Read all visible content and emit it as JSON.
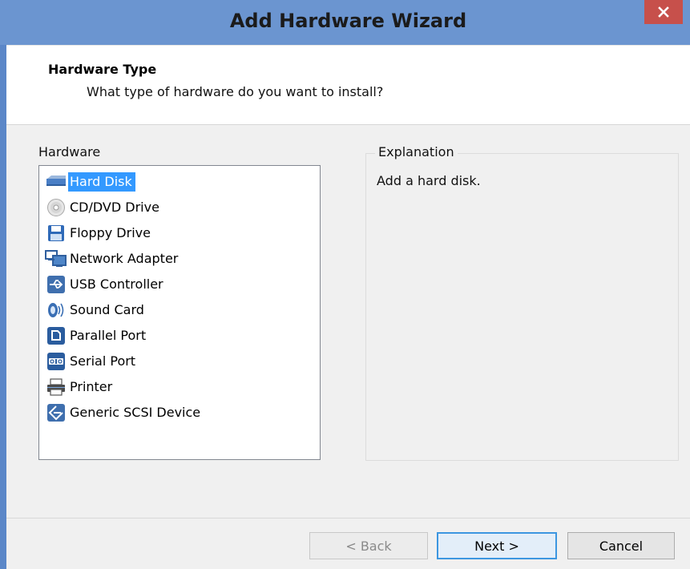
{
  "window": {
    "title": "Add Hardware Wizard",
    "close_glyph": "✕"
  },
  "header": {
    "title": "Hardware Type",
    "subtitle": "What type of hardware do you want to install?"
  },
  "hardware": {
    "label": "Hardware",
    "selected": "Hard Disk",
    "items": [
      {
        "label": "Hard Disk",
        "icon": "hard-disk-icon"
      },
      {
        "label": "CD/DVD Drive",
        "icon": "cd-dvd-icon"
      },
      {
        "label": "Floppy Drive",
        "icon": "floppy-icon"
      },
      {
        "label": "Network Adapter",
        "icon": "network-adapter-icon"
      },
      {
        "label": "USB Controller",
        "icon": "usb-icon"
      },
      {
        "label": "Sound Card",
        "icon": "sound-card-icon"
      },
      {
        "label": "Parallel Port",
        "icon": "parallel-port-icon"
      },
      {
        "label": "Serial Port",
        "icon": "serial-port-icon"
      },
      {
        "label": "Printer",
        "icon": "printer-icon"
      },
      {
        "label": "Generic SCSI Device",
        "icon": "scsi-icon"
      }
    ]
  },
  "explanation": {
    "legend": "Explanation",
    "text": "Add a hard disk."
  },
  "buttons": {
    "back": "< Back",
    "next": "Next >",
    "cancel": "Cancel"
  },
  "colors": {
    "titlebar": "#6b95d0",
    "close": "#c7504b",
    "selection": "#3399ff"
  }
}
